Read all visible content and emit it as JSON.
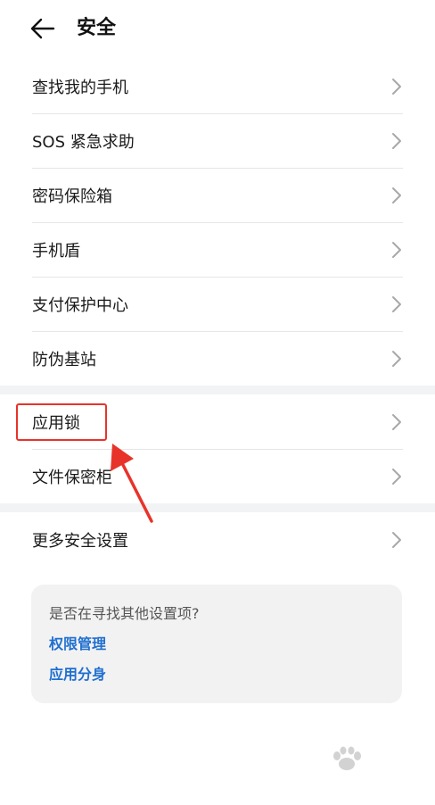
{
  "header": {
    "title": "安全",
    "back_icon": "arrow-left-icon"
  },
  "sections": [
    {
      "items": [
        {
          "label": "查找我的手机"
        },
        {
          "label": "SOS 紧急求助"
        },
        {
          "label": "密码保险箱"
        },
        {
          "label": "手机盾"
        },
        {
          "label": "支付保护中心"
        },
        {
          "label": "防伪基站"
        }
      ]
    },
    {
      "items": [
        {
          "label": "应用锁",
          "highlighted": true
        },
        {
          "label": "文件保密柜"
        }
      ]
    },
    {
      "items": [
        {
          "label": "更多安全设置"
        }
      ]
    }
  ],
  "suggestions": {
    "title": "是否在寻找其他设置项?",
    "links": [
      "权限管理",
      "应用分身"
    ]
  },
  "annotation": {
    "color": "#e8332a",
    "target": "应用锁"
  },
  "colors": {
    "link": "#1f6fd0",
    "divider": "#e6e6e6",
    "section_gap": "#f1f3f5",
    "card_bg": "#f2f2f2"
  }
}
